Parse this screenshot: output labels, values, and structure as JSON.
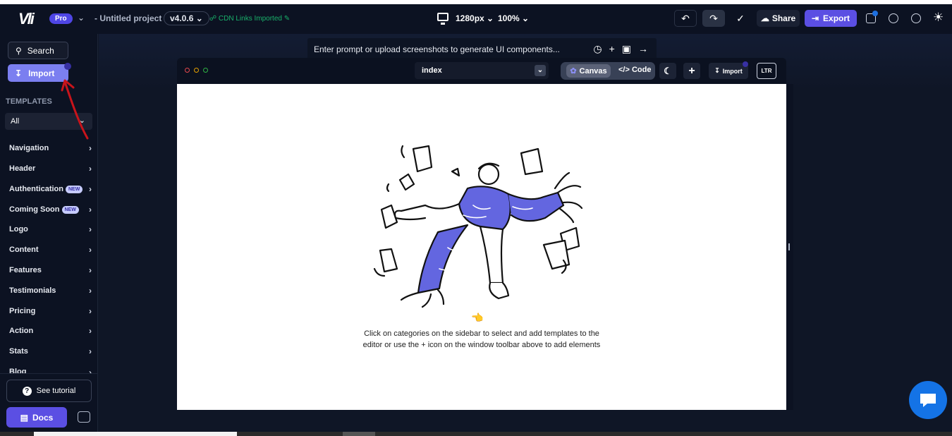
{
  "app": {
    "logo_text": "Vli",
    "plan_badge": "Pro",
    "project_title": "- Untitled project",
    "version": "v4.0.6",
    "cdn_status": "CDN Links Imported",
    "resolution": "1280px",
    "zoom": "100%"
  },
  "toolbar": {
    "share_label": "Share",
    "export_label": "Export"
  },
  "sidebar": {
    "search_label": "Search",
    "import_label": "Import",
    "templates_heading": "TEMPLATES",
    "filter_value": "All",
    "items": [
      {
        "label": "Navigation",
        "badge": ""
      },
      {
        "label": "Header",
        "badge": ""
      },
      {
        "label": "Authentication",
        "badge": "NEW"
      },
      {
        "label": "Coming Soon",
        "badge": "NEW"
      },
      {
        "label": "Logo",
        "badge": ""
      },
      {
        "label": "Content",
        "badge": ""
      },
      {
        "label": "Features",
        "badge": ""
      },
      {
        "label": "Testimonials",
        "badge": ""
      },
      {
        "label": "Pricing",
        "badge": ""
      },
      {
        "label": "Action",
        "badge": ""
      },
      {
        "label": "Stats",
        "badge": ""
      },
      {
        "label": "Blog",
        "badge": ""
      }
    ],
    "tutorial_label": "See tutorial",
    "docs_label": "Docs"
  },
  "prompt": {
    "placeholder": "Enter prompt or upload screenshots to generate UI components..."
  },
  "window": {
    "page_name": "index",
    "canvas_label": "Canvas",
    "code_label": "Code",
    "import_label": "Import",
    "direction_label": "LTR"
  },
  "canvas": {
    "caption_line1": "Click on categories on the sidebar to select and add templates to the",
    "caption_line2": "editor or use the + icon on the window toolbar above to add elements"
  },
  "colors": {
    "accent": "#5b4fe3",
    "import_button": "#7b7ff0",
    "cdn_green": "#19b26b",
    "chat_fab": "#1473e6"
  }
}
